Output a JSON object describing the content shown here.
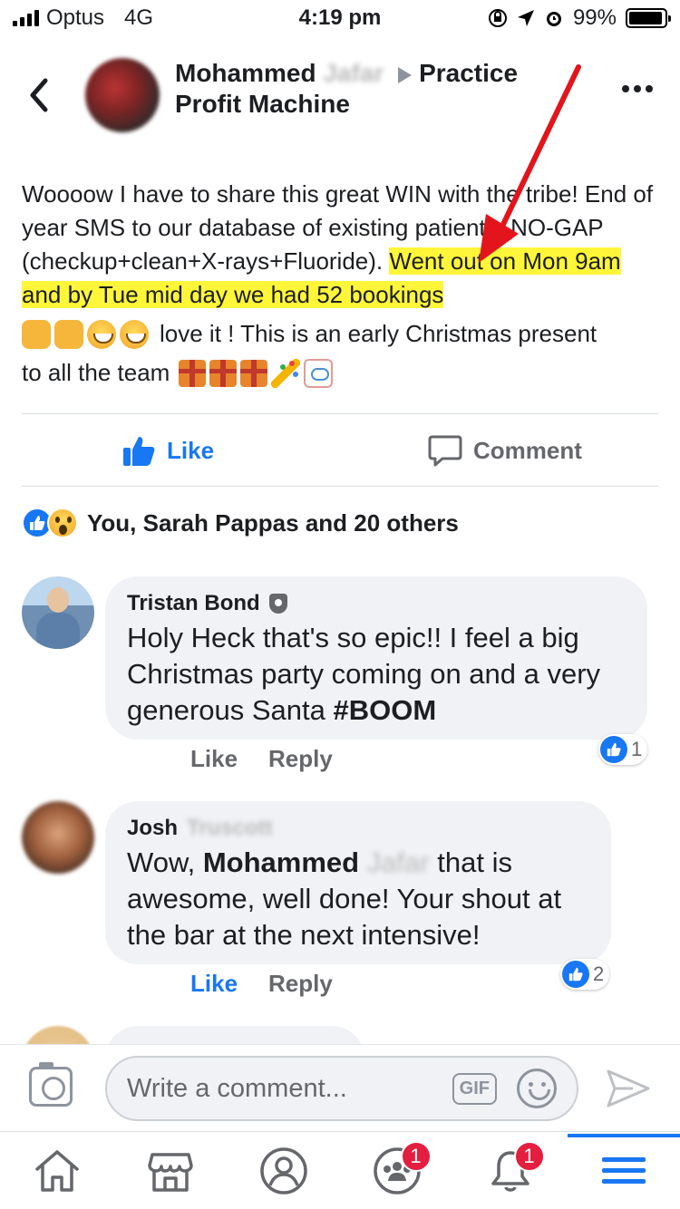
{
  "status_bar": {
    "carrier": "Optus",
    "network": "4G",
    "time": "4:19 pm",
    "battery": "99%",
    "battery_level": 0.99
  },
  "post": {
    "author_first": "Mohammed",
    "author_last_blurred": "Jafar",
    "group": "Practice Profit Machine",
    "text_plain": "Woooow I have to share this great WIN with the tribe! End of year SMS to our database of existing patients, NO-GAP (checkup+clean+X-rays+Fluoride). ",
    "text_highlight": "Went out on Mon 9am and by Tue mid day we had 52 bookings",
    "text_after_emoji": "love it ! This is an early Christmas present",
    "text_last_line": "to all the team"
  },
  "actions": {
    "like": "Like",
    "comment": "Comment"
  },
  "reactions": {
    "summary": "You, Sarah Pappas and 20 others"
  },
  "comments": [
    {
      "name": "Tristan Bond",
      "text": "Holy Heck that's so epic!! I feel a big Christmas party coming on and a very generous Santa ",
      "text_bold": "#BOOM",
      "like": "Like",
      "reply": "Reply",
      "like_count": "1"
    },
    {
      "name": "Josh",
      "name_blurred": "Truscott",
      "text_prefix": "Wow, ",
      "mention": "Mohammed",
      "mention_blurred": "Jafar",
      "text_suffix": " that is awesome, well done!  Your shout at the bar at the next intensive!",
      "like": "Like",
      "reply": "Reply",
      "like_count": "2"
    }
  ],
  "composer": {
    "placeholder": "Write a comment...",
    "gif": "GIF"
  },
  "bottom_nav": {
    "groups_badge": "1",
    "notifications_badge": "1"
  },
  "colors": {
    "brand_blue": "#1877f2",
    "highlight": "#fff63a",
    "badge_red": "#e41e3f"
  }
}
